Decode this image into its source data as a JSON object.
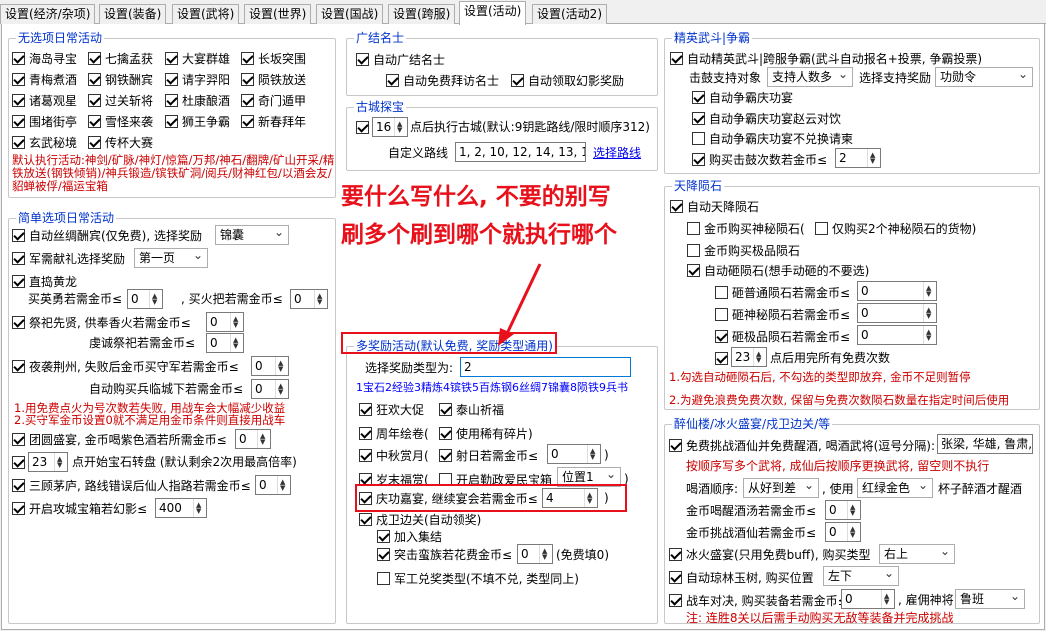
{
  "tabs": [
    "设置(经济/杂项)",
    "设置(装备)",
    "设置(武将)",
    "设置(世界)",
    "设置(国战)",
    "设置(跨服)",
    "设置(活动)",
    "设置(活动2)"
  ],
  "no_option_daily": {
    "title": "无选项日常活动",
    "items": [
      "海岛寻宝",
      "七擒孟获",
      "大宴群雄",
      "长坂突围",
      "青梅煮酒",
      "钢铁酬宾",
      "请字羿阳",
      "陨铁放送",
      "诸葛观星",
      "过关斩将",
      "杜康酿酒",
      "奇门遁甲",
      "围堵街亭",
      "雪怪来袭",
      "狮王争霸",
      "新春拜年",
      "玄武秘境",
      "传杯大赛"
    ],
    "note": "默认执行活动:神剑/矿脉/神灯/惊篇/万邦/神石/翻牌/矿山开采/精铁放送(钢铁倾销)/神兵锻造/镔铁矿洞/阅兵/财神红包/以酒会友/貂蝉被俘/福运宝箱"
  },
  "simple_daily": {
    "title": "简单选项日常活动",
    "silk": "自动丝绸酬宾(仅免费), 选择奖励",
    "silk_value": "锦囊",
    "military": "军需献礼选择奖励",
    "military_value": "第一页",
    "zhidao": "直捣黄龙",
    "buy_brave": "买英勇若需金币≤",
    "buy_brave_value": "0",
    "buy_torch": ", 买火把若需金币≤",
    "buy_torch_value": "0",
    "sacrifice": "祭祀先贤, 供奉香火若需金币≤",
    "sacrifice_value": "0",
    "sincere": "虔诚祭祀若需金币≤",
    "sincere_value": "0",
    "night_raid": "夜袭荆州, 失败后金币买守军若需金币≤",
    "night_raid_value": "0",
    "auto_buy_soldier": "自动购买兵临城下若需金币≤",
    "auto_buy_soldier_value": "0",
    "night_note": "1.用免费点火为号次数若失败, 用战车会大幅减少收益\n2.买守军金币设置0就不满足用金币条件则直接用战车",
    "reunion": "团圆盛宴, 金币喝紫色酒若所需金币≤",
    "reunion_value": "0",
    "jade_value": "23",
    "jade": "点开始宝石转盘 (默认剩余2次用最高倍率)",
    "three_visits": "三顾茅庐, 路线错误后仙人指路若需金币≤",
    "three_visits_value": "0",
    "attack_city": "开启攻城宝箱若幻影≤",
    "attack_city_value": "400"
  },
  "recruit": {
    "title": "广结名士",
    "auto": "自动广结名士",
    "free_visit": "自动免费拜访名士",
    "claim_reward": "自动领取幻影奖励"
  },
  "ancient_city": {
    "title": "古城探宝",
    "count_value": "16",
    "exec": "点后执行古城(默认:9钥匙路线/限时顺序312)",
    "route_label": "自定义路线",
    "route_value": "1, 2, 10, 12, 14, 13, 11, 4,",
    "select_route": "选择路线"
  },
  "multi_reward": {
    "title": "多奖励活动(默认免费, 奖励类型通用)",
    "select_label": "选择奖励类型为:",
    "select_value": "2",
    "legend": "1宝石2经验3精炼4镔铁5百炼钢6丝绸7锦囊8陨铁9兵书",
    "carnival": "狂欢大促",
    "taishan": "泰山祈福",
    "anniversary": "周年绘卷(",
    "use_rare": "使用稀有碎片)",
    "mid_autumn": "中秋赏月(",
    "shoot_sun": "射日若需金币≤",
    "shoot_sun_value": "0",
    "year_end": "岁末福赏(",
    "open_box": "开启勤政爱民宝箱",
    "open_box_pos": "位置1",
    "celebrate": "庆功嘉宴, 继续宴会若需金币≤",
    "celebrate_value": "4",
    "frontier": "戍卫边关(自动领奖)",
    "add_gather": "加入集结",
    "charge": "突击蛮族若花费金币≤",
    "charge_value": "0",
    "charge_free": "(免费填0)",
    "exchange": "军工兑奖类型(不填不兑, 类型同上)"
  },
  "elite": {
    "title": "精英武斗|争霸",
    "auto": "自动精英武斗|跨服争霸(武斗自动报名+投票, 争霸投票)",
    "vote_target_label": "击鼓支持对象",
    "vote_target": "支持人数多",
    "vote_reward_label": "选择支持奖励",
    "vote_reward": "功勋令",
    "celebrate": "自动争霸庆功宴",
    "celebrate_drink": "自动争霸庆功宴赵云对饮",
    "celebrate_no_gold": "自动争霸庆功宴不兑换请柬",
    "buy_drum": "购买击鼓次数若金币≤",
    "buy_drum_value": "2"
  },
  "meteor": {
    "title": "天降陨石",
    "auto": "自动天降陨石",
    "buy_mystery": "金币购买神秘陨石(",
    "only_two": "仅购买2个神秘陨石的货物)",
    "buy_best": "金币购买极品陨石",
    "auto_smash": "自动砸陨石(想手动砸的不要选)",
    "smash_normal": "砸普通陨石若需金币≤",
    "smash_normal_value": "0",
    "smash_mystery": "砸神秘陨石若需金币≤",
    "smash_mystery_value": "0",
    "smash_best": "砸极品陨石若需金币≤",
    "smash_best_value": "0",
    "free_value": "23",
    "free_label": "点后用完所有免费次数",
    "note1": "1.勾选自动砸陨石后, 不勾选的类型即放弃, 金币不足则暂停",
    "note2": "2.为避免浪费免费次数, 保留与免费次数陨石数量在指定时间后使用"
  },
  "drunk": {
    "title": "醉仙楼/冰火盛宴/戍卫边关/等",
    "free_challenge": "免费挑战酒仙并免费醒酒, 喝酒武将(逗号分隔):",
    "generals": "张梁, 华雄, 鲁肃,",
    "note": "按顺序写多个武将, 成仙后按顺序更换武将, 留空则不执行",
    "order_label": "喝酒顺序:",
    "order_value": "从好到差",
    "use_label": ", 使用",
    "use_value": "红绿金色",
    "cup_label": "杯子醉酒才醒酒",
    "gold_sober": "金币喝醒酒汤若需金币≤",
    "gold_sober_value": "0",
    "gold_challenge": "金币挑战酒仙若需金币≤",
    "gold_challenge_value": "0",
    "ice_fire": "冰火盛宴(只用免费buff), 购买类型",
    "ice_fire_value": "右上",
    "jade_tree": "自动琼林玉树, 购买位置",
    "jade_tree_value": "左下",
    "chariot": "战车对决, 购买装备若需金币≤",
    "chariot_value": "0",
    "hire_label": ", 雇佣神将",
    "hire_value": "鲁班",
    "warning": "注: 连胜8关以后需手动购买无敌等装备并完成挑战"
  },
  "annotation": {
    "line1": "要什么写什么, 不要的别写",
    "line2": "刷多个刷到哪个就执行哪个"
  }
}
